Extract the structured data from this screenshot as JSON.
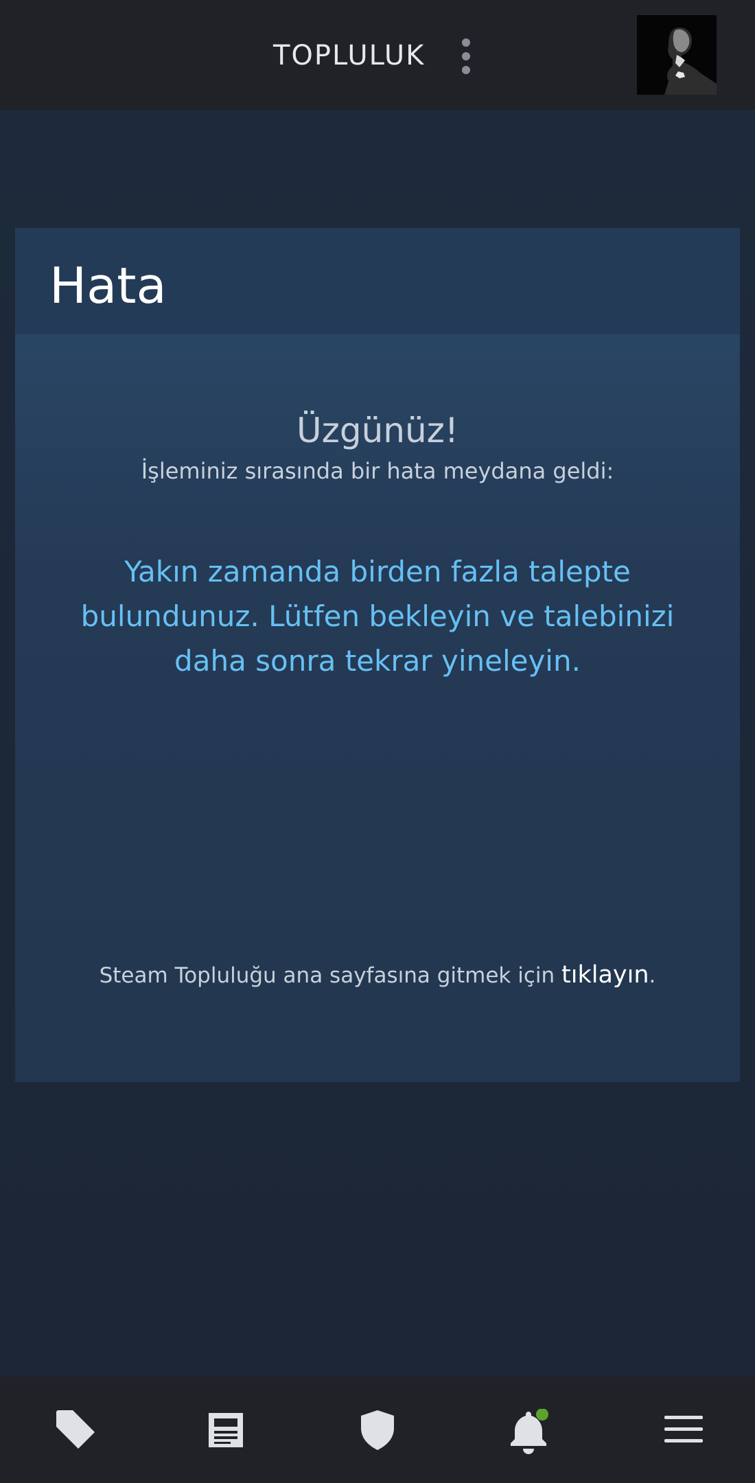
{
  "header": {
    "title": "TOPLULUK",
    "menu_icon": "kebab-menu-icon",
    "avatar_icon": "user-avatar"
  },
  "error_card": {
    "title": "Hata",
    "sorry": "Üzgünüz!",
    "subtitle": "İşleminiz sırasında bir hata meydana geldi:",
    "message": "Yakın zamanda birden fazla talepte bulundunuz. Lütfen bekleyin ve talebinizi daha sonra tekrar yineleyin.",
    "footer_prefix": "Steam Topluluğu ana sayfasına gitmek için ",
    "footer_link": "tıklayın",
    "footer_suffix": "."
  },
  "bottom_nav": {
    "items": [
      {
        "icon": "tag-icon"
      },
      {
        "icon": "news-icon"
      },
      {
        "icon": "shield-icon"
      },
      {
        "icon": "bell-icon",
        "badge": "green-dot"
      },
      {
        "icon": "hamburger-menu-icon"
      }
    ]
  },
  "colors": {
    "accent": "#66c0f4",
    "bar_bg": "#202228",
    "page_bg": "#1c2636",
    "notification_badge": "#5ba32b"
  }
}
